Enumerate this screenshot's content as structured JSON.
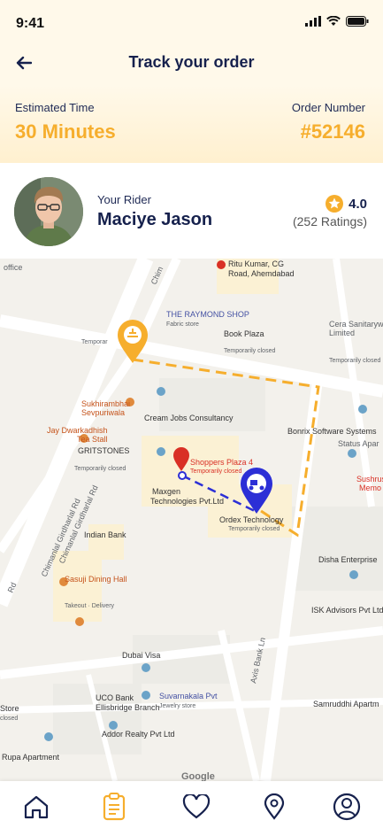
{
  "status_bar": {
    "time": "9:41"
  },
  "header": {
    "title": "Track your order"
  },
  "order": {
    "estimated_label": "Estimated Time",
    "estimated_value": "30 Minutes",
    "number_label": "Order Number",
    "number_value": "#52146"
  },
  "rider": {
    "label": "Your Rider",
    "name": "Maciye Jason",
    "rating": "4.0",
    "ratings_count": "(252 Ratings)"
  },
  "map": {
    "places": [
      "office",
      "Ritu Kumar, CG",
      "Road, Ahemdabad",
      "THE RAYMOND SHOP",
      "Fabric store",
      "Book Plaza",
      "Temporarily closed",
      "Cera Sanitaryw",
      "Limited",
      "Temporarily closed",
      "Sukhirambhai",
      "Sevpuriwala",
      "Cream Jobs Consultancy",
      "Bonrix Software Systems",
      "Status Apar",
      "Jay Dwarkadhish",
      "Tea Stall",
      "GRITSTONES",
      "Temporarily closed",
      "Shoppers Plaza 4",
      "Temporarily closed",
      "Maxgen",
      "Technologies Pvt.Ltd",
      "Ordex Technology",
      "Temporarily closed",
      "Sushrus",
      "Memo",
      "Indian Bank",
      "Disha Enterprise",
      "Sasuji Dining Hall",
      "Takeout · Delivery",
      "ISK Advisors Pvt Ltd",
      "Dubai Visa",
      "UCO Bank",
      "Ellisbridge Branch",
      "Suvarnakala Pvt",
      "Jewelry store",
      "Samruddhi Apartm",
      "Addor Realty Pvt Ltd",
      "Rupa Apartment",
      "Store",
      "closed",
      "Temporar",
      "Google"
    ],
    "roads": [
      "Chimanlal Girdharlal Rd",
      "Chimanlal Girdharlal Rd",
      "Axis Bank Ln",
      "Rd",
      "Chim"
    ]
  },
  "tabs": [
    {
      "name": "home",
      "icon": "home-icon"
    },
    {
      "name": "orders",
      "icon": "clipboard-icon"
    },
    {
      "name": "favorites",
      "icon": "heart-icon"
    },
    {
      "name": "location",
      "icon": "location-pin-icon"
    },
    {
      "name": "profile",
      "icon": "profile-icon"
    }
  ],
  "colors": {
    "accent": "#f6ae2d",
    "primary": "#16214d",
    "route_blue": "#2c2fd6",
    "pin_red": "#d93025"
  }
}
